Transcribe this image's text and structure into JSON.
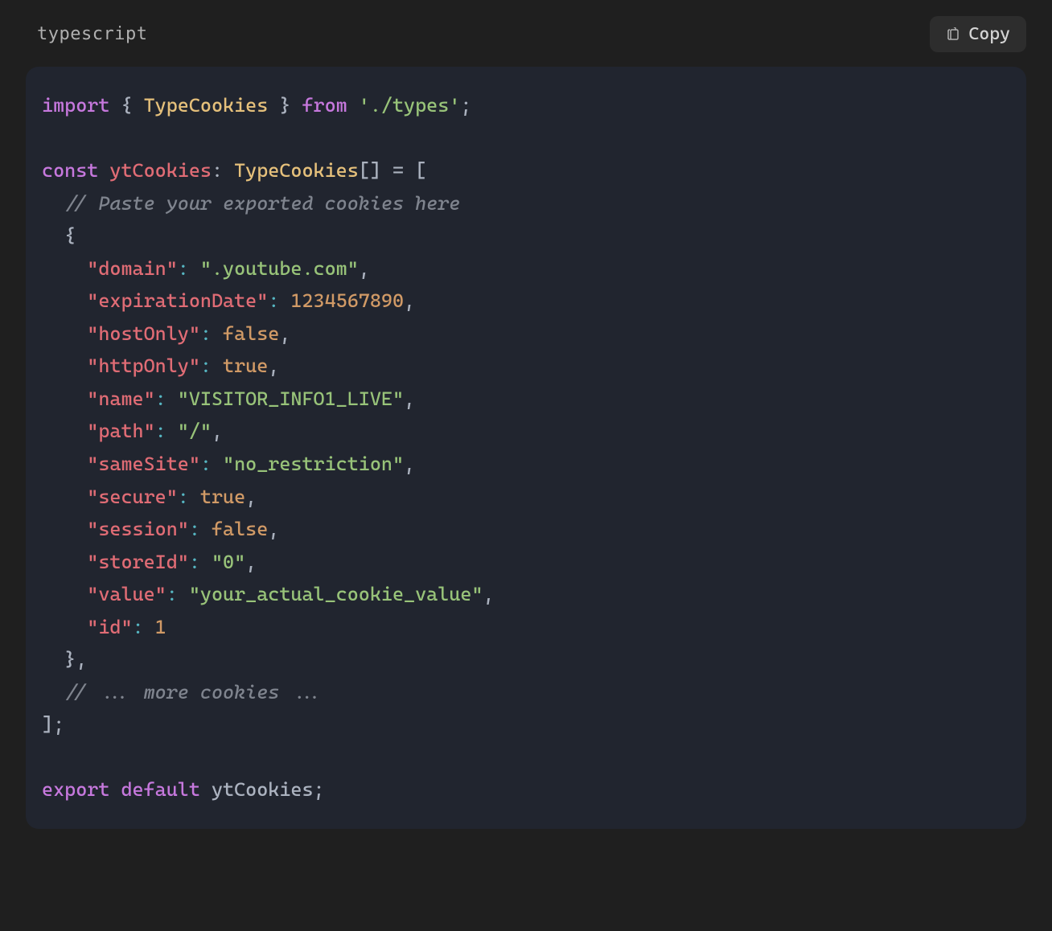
{
  "header": {
    "language_label": "typescript",
    "copy_label": "Copy"
  },
  "code": {
    "kw_import": "import",
    "lbrace1": " { ",
    "import_ident": "TypeCookies",
    "rbrace1": " } ",
    "kw_from": "from",
    "sp1": " ",
    "import_path": "'./types'",
    "semi1": ";",
    "blank1": "",
    "kw_const": "const",
    "sp2": " ",
    "var_name": "ytCookies",
    "colon_type": ": ",
    "type_ann": "TypeCookies",
    "arr_suffix": "[] = [",
    "comment1": "// Paste your exported cookies here",
    "obj_open": "  {",
    "p_domain_k": "\"domain\"",
    "p_domain_v": "\".youtube.com\"",
    "p_exp_k": "\"expirationDate\"",
    "p_exp_v": "1234567890",
    "p_hostOnly_k": "\"hostOnly\"",
    "p_hostOnly_v": "false",
    "p_httpOnly_k": "\"httpOnly\"",
    "p_httpOnly_v": "true",
    "p_name_k": "\"name\"",
    "p_name_v": "\"VISITOR_INFO1_LIVE\"",
    "p_path_k": "\"path\"",
    "p_path_v": "\"/\"",
    "p_sameSite_k": "\"sameSite\"",
    "p_sameSite_v": "\"no_restriction\"",
    "p_secure_k": "\"secure\"",
    "p_secure_v": "true",
    "p_session_k": "\"session\"",
    "p_session_v": "false",
    "p_storeId_k": "\"storeId\"",
    "p_storeId_v": "\"0\"",
    "p_value_k": "\"value\"",
    "p_value_v": "\"your_actual_cookie_value\"",
    "p_id_k": "\"id\"",
    "p_id_v": "1",
    "obj_close": "  },",
    "comment2": "// ... more cookies ...",
    "arr_close": "];",
    "blank2": "",
    "kw_export": "export",
    "sp3": " ",
    "kw_default": "default",
    "sp4": " ",
    "export_ident": "ytCookies",
    "semi2": ";"
  }
}
